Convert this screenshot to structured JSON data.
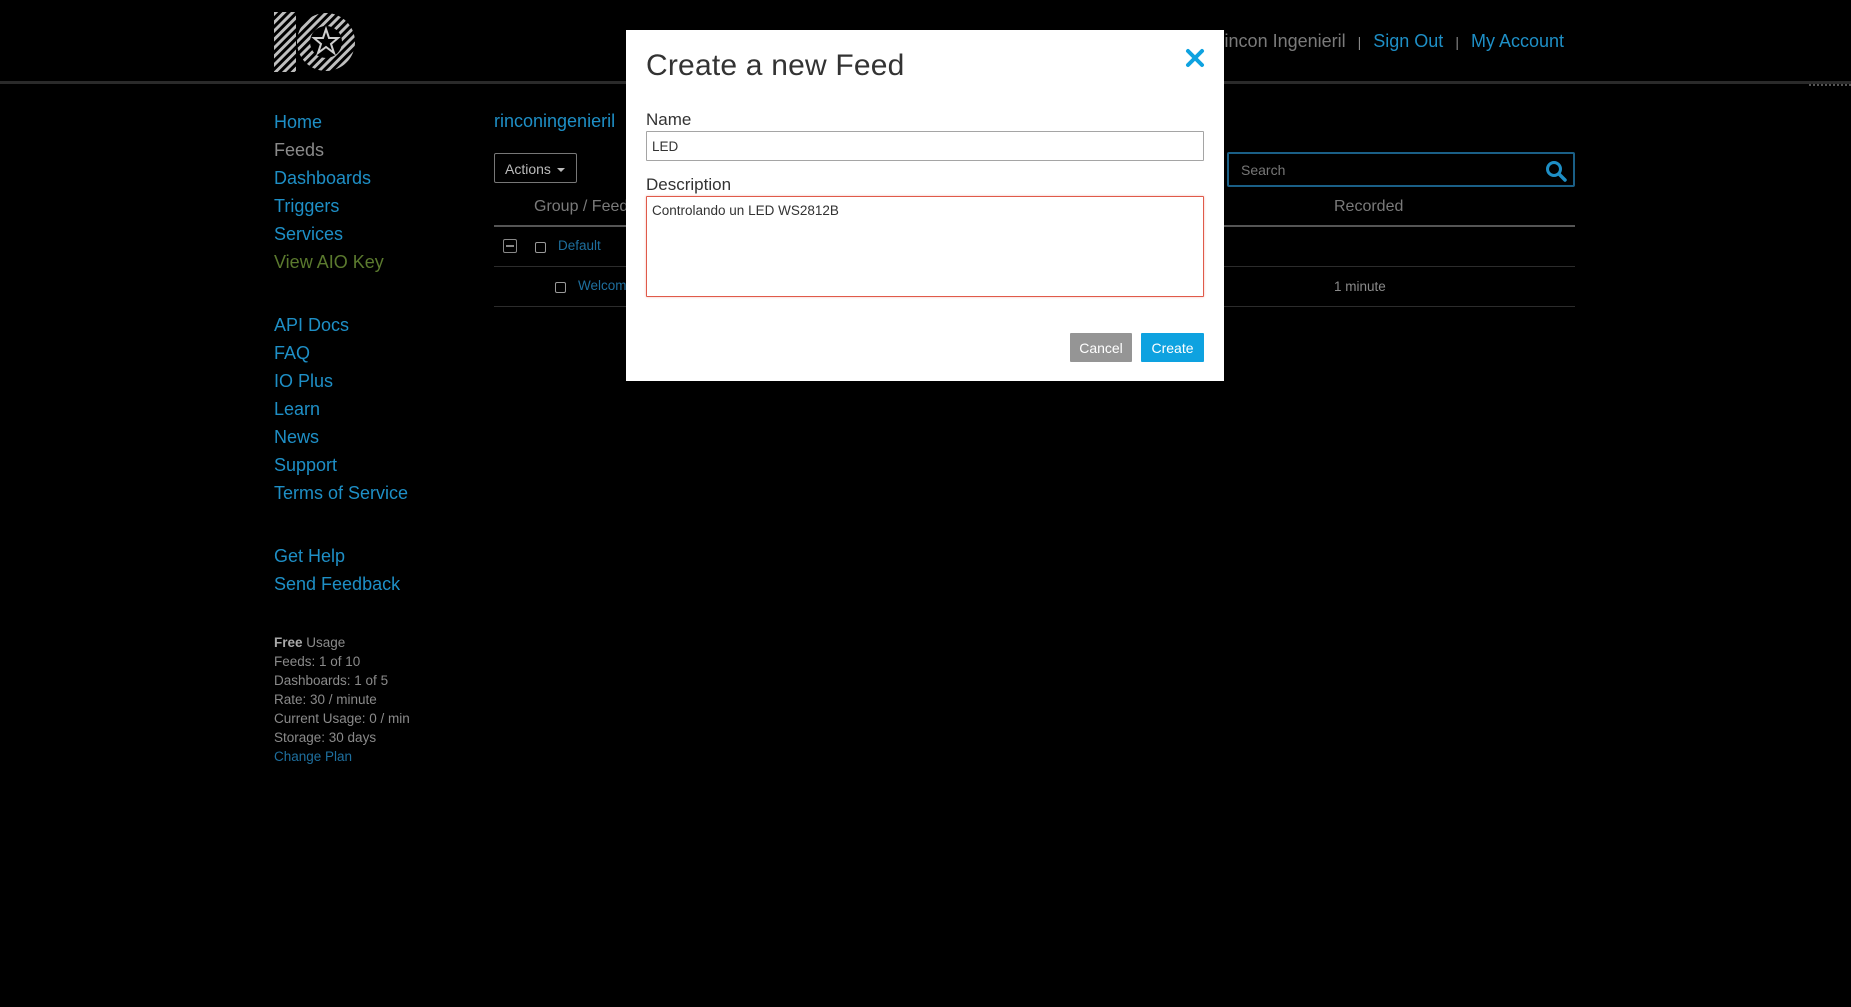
{
  "header": {
    "user_name": "Rincon Ingenieril",
    "sign_out": "Sign Out",
    "my_account": "My Account",
    "separator": "|"
  },
  "sidebar": {
    "nav_primary": [
      "Home",
      "Feeds",
      "Dashboards",
      "Triggers",
      "Services",
      "View AIO Key"
    ],
    "nav_help": [
      "API Docs",
      "FAQ",
      "IO Plus",
      "Learn",
      "News",
      "Support",
      "Terms of Service"
    ],
    "nav_feedback": [
      "Get Help",
      "Send Feedback"
    ],
    "usage": {
      "plan_label": "Free",
      "plan_suffix": " Usage",
      "feeds": "Feeds: 1 of 10",
      "dashboards": "Dashboards: 1 of 5",
      "rate": "Rate: 30 / minute",
      "current_usage": "Current Usage: 0 / min",
      "storage": "Storage: 30 days",
      "change_plan": "Change Plan"
    }
  },
  "main": {
    "breadcrumb": "rinconingenieril",
    "actions_label": "Actions",
    "search_placeholder": "Search",
    "columns": {
      "group_feed": "Group / Feed",
      "recorded": "Recorded"
    },
    "rows": {
      "group_name": "Default",
      "feed_name": "Welcome Feed",
      "feed_recorded": "1 minute"
    }
  },
  "modal": {
    "title": "Create a new Feed",
    "name_label": "Name",
    "name_value": "LED",
    "description_label": "Description",
    "description_value": "Controlando un LED WS2812B",
    "cancel_label": "Cancel",
    "create_label": "Create"
  },
  "colors": {
    "link": "#1e8fc6",
    "create_button": "#0ea2e0",
    "cancel_button": "#959595",
    "description_border": "#e05a4a"
  }
}
